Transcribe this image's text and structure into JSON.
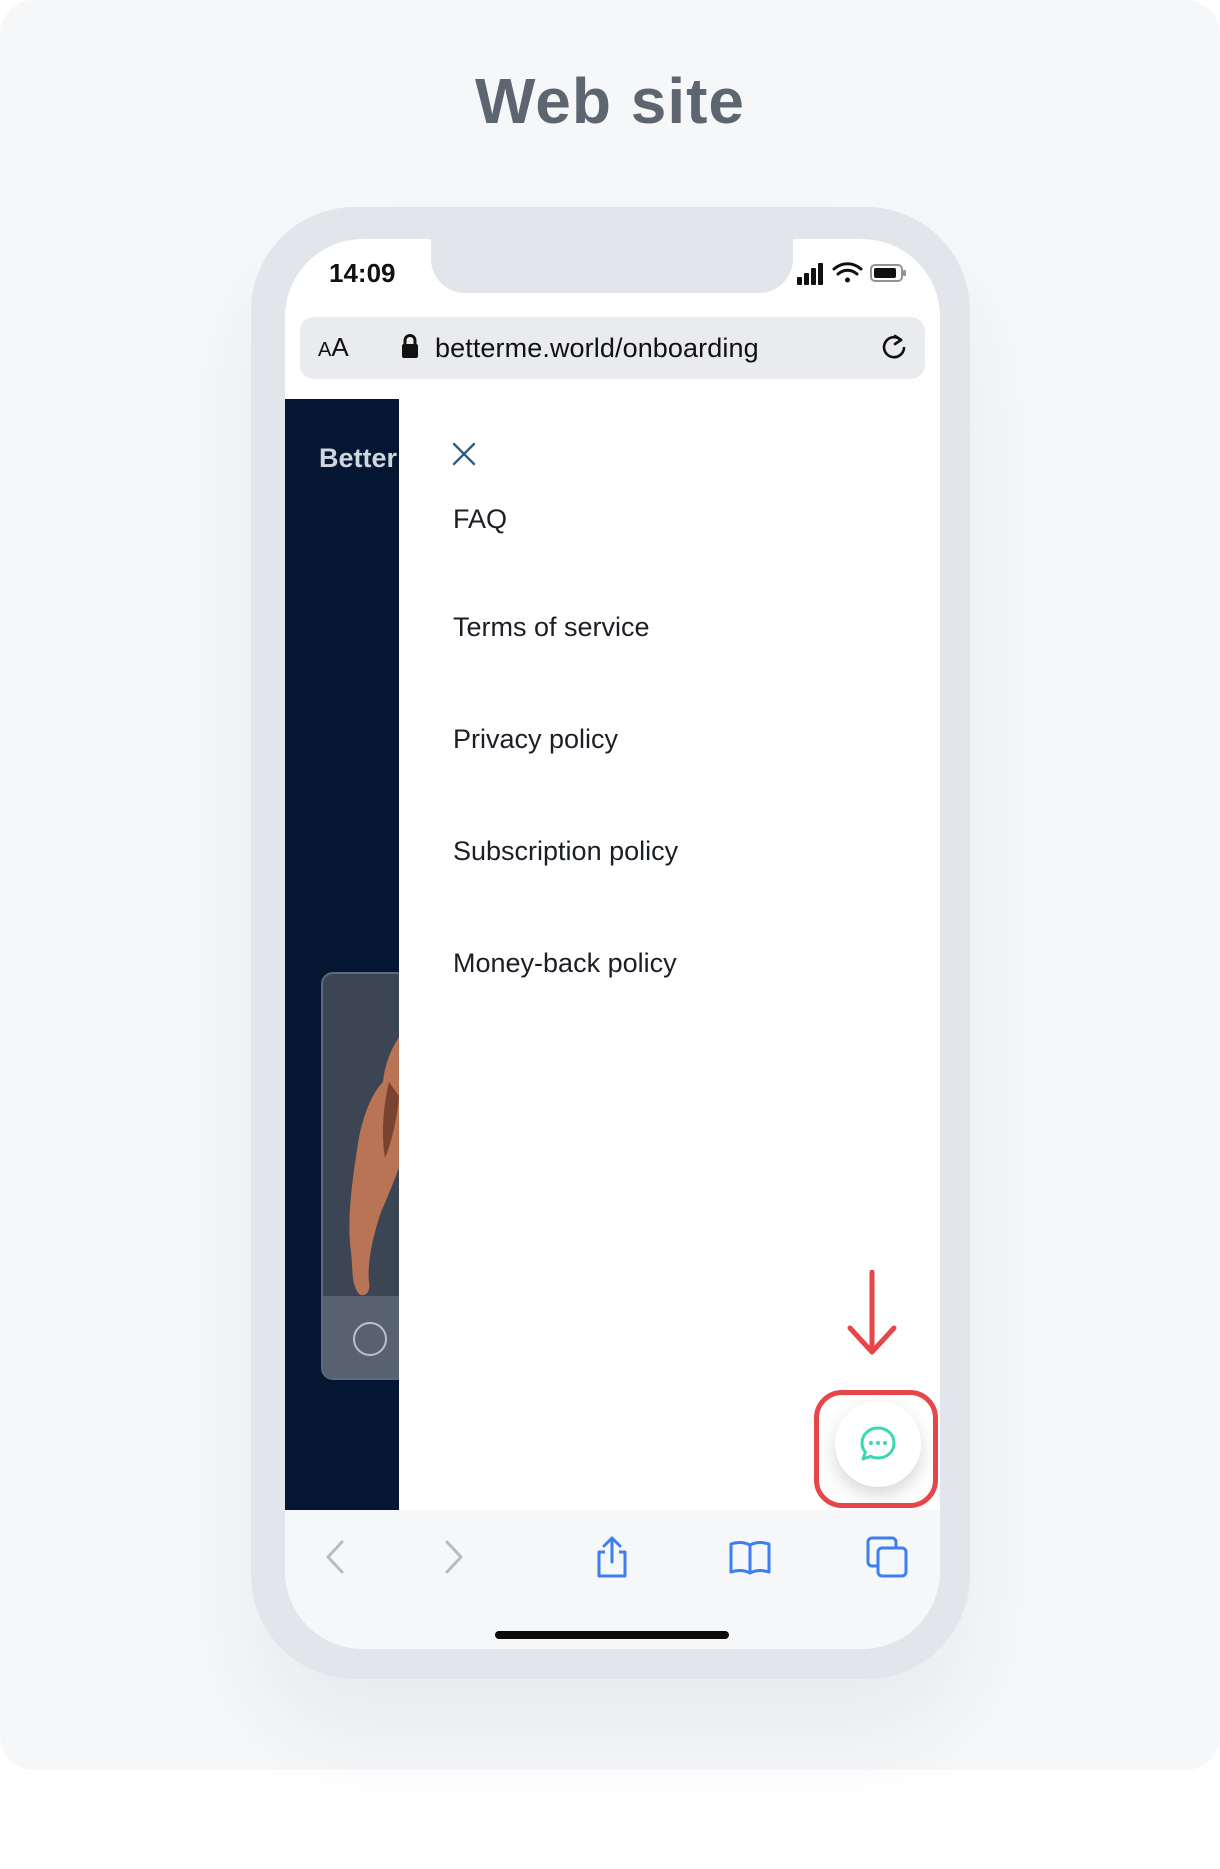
{
  "page": {
    "title": "Web site"
  },
  "status_bar": {
    "time": "14:09"
  },
  "browser": {
    "aa_label_small": "A",
    "aa_label_large": "A",
    "url": "betterme.world/onboarding"
  },
  "background_page": {
    "brand_text": "Better"
  },
  "menu": {
    "items": [
      {
        "label": "FAQ"
      },
      {
        "label": "Terms of service"
      },
      {
        "label": "Privacy policy"
      },
      {
        "label": "Subscription policy"
      },
      {
        "label": "Money-back policy"
      }
    ]
  },
  "icons": {
    "close": "close-icon",
    "chat": "chat-bubble-icon",
    "lock": "lock-icon",
    "reload": "reload-icon",
    "back": "chevron-left-icon",
    "forward": "chevron-right-icon",
    "share": "share-icon",
    "bookmarks": "book-icon",
    "tabs": "tabs-icon"
  },
  "colors": {
    "accent_teal": "#39d8b5",
    "annotation_red": "#e64649",
    "browser_blue": "#3d7ef0",
    "background_navy": "#041631"
  }
}
